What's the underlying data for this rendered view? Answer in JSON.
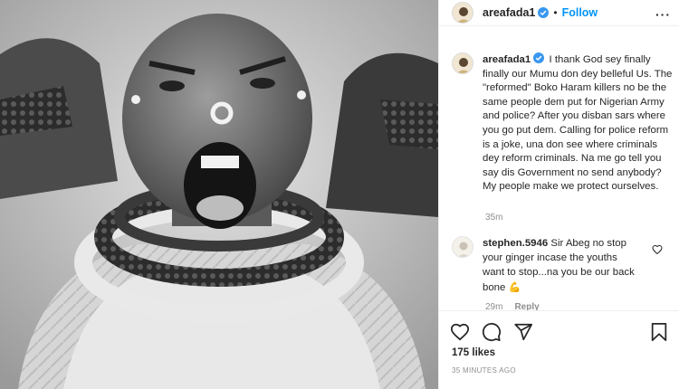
{
  "post": {
    "username": "areafada1",
    "follow_label": "Follow",
    "separator": "•",
    "more_label": "···"
  },
  "caption": {
    "username": "areafada1",
    "text": "I thank God sey finally finally our Mumu don dey belleful Us. The \"reformed\" Boko Haram killers no be the same people dem put for Nigerian Army and police? After you disban sars where you go put dem. Calling for police reform is a joke, una don see where criminals dey reform criminals. Na me go tell you say dis Government no send anybody?\nMy people make we protect ourselves.",
    "time": "35m"
  },
  "comment": {
    "username": "stephen.5946",
    "text": "Sir Abeg no stop your ginger incase the youths want to stop...na you be our back bone",
    "emoji": "💪",
    "time": "29m",
    "reply_label": "Reply"
  },
  "footer": {
    "likes": "175 likes",
    "posted": "35 MINUTES AGO"
  },
  "icons": [
    "more-icon",
    "verified-badge-icon",
    "heart-icon",
    "comment-icon",
    "share-icon",
    "bookmark-icon",
    "small-heart-icon"
  ],
  "colors": {
    "accent": "#0095f6",
    "verified": "#3897f0",
    "muted": "#8e8e8e",
    "text": "#262626",
    "border": "#efefef"
  }
}
